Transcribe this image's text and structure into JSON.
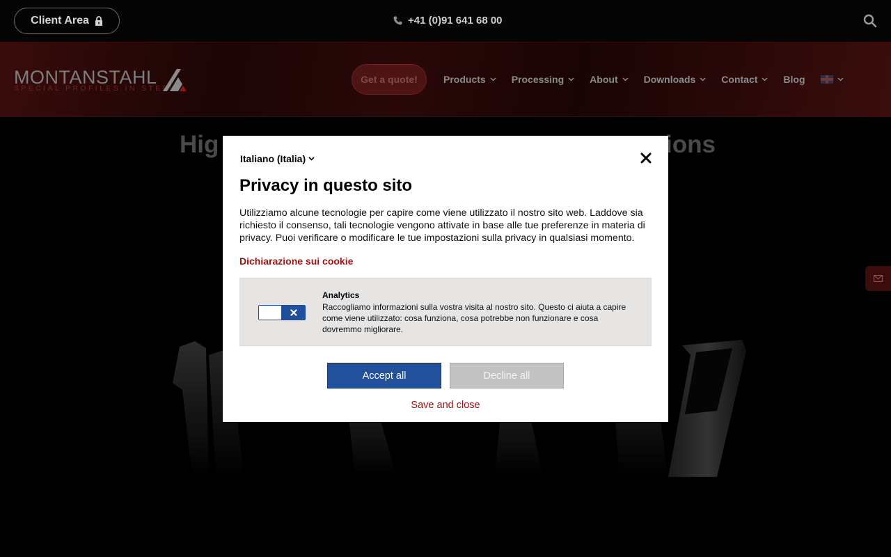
{
  "topbar": {
    "client_area": "Client Area",
    "phone": "+41 (0)91 641 68 00"
  },
  "header": {
    "logo_word": "MONTANSTAHL",
    "logo_tagline": "SPECIAL PROFILES IN STEEL",
    "quote_button": "Get a quote!",
    "nav": [
      "Products",
      "Processing",
      "About",
      "Downloads",
      "Contact",
      "Blog"
    ]
  },
  "hero": {
    "title_left": "Hig",
    "title_right": "ions"
  },
  "cookie_modal": {
    "language": "Italiano (Italia)",
    "title": "Privacy in questo sito",
    "body": "Utilizziamo alcune tecnologie per capire come viene utilizzato il nostro sito web. Laddove sia richiesto il consenso, tali tecnologie vengono attivate in base alle tue preferenze in materia di privacy. Puoi verificare o modificare le tue impostazioni sulla privacy in qualsiasi momento.",
    "cookie_link": "Dichiarazione sui cookie",
    "analytics": {
      "title": "Analytics",
      "text": "Raccogliamo informazioni sulla vostra visita al nostro sito. Questo ci aiuta a capire come viene utilizzato: cosa funziona, cosa potrebbe non funzionare e cosa dovremmo migliorare.",
      "enabled": false
    },
    "accept_label": "Accept all",
    "decline_label": "Decline all",
    "save_label": "Save and close"
  },
  "colors": {
    "accent_red": "#a30f0f",
    "accept_blue": "#22509a",
    "header_red": "#2a0808"
  }
}
